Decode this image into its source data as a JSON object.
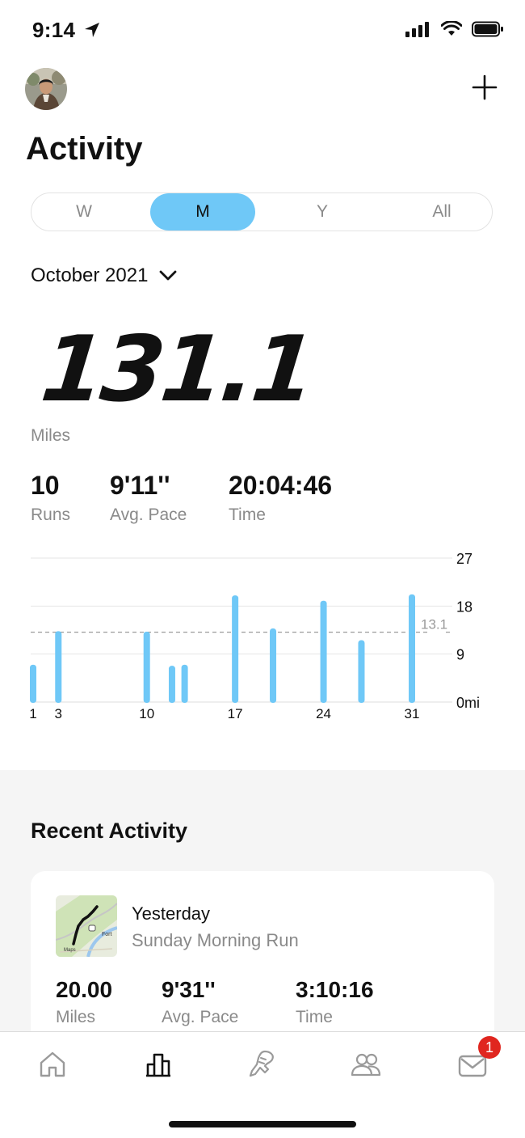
{
  "status_bar": {
    "time": "9:14"
  },
  "header": {
    "title": "Activity"
  },
  "segments": [
    "W",
    "M",
    "Y",
    "All"
  ],
  "selected_segment": "M",
  "month_selector": {
    "label": "October 2021"
  },
  "summary": {
    "distance": "131.1",
    "distance_label": "Miles",
    "stats": [
      {
        "value": "10",
        "label": "Runs"
      },
      {
        "value": "9'11''",
        "label": "Avg. Pace"
      },
      {
        "value": "20:04:46",
        "label": "Time"
      }
    ]
  },
  "chart_data": {
    "type": "bar",
    "x_ticks": [
      "1",
      "3",
      "10",
      "17",
      "24",
      "31"
    ],
    "y_ticks": [
      "27",
      "18",
      "9",
      "0mi"
    ],
    "ylim": [
      0,
      27
    ],
    "average_line": {
      "value": 13.1,
      "label": "13.1"
    },
    "days": [
      1,
      3,
      10,
      12,
      13,
      17,
      20,
      24,
      27,
      31
    ],
    "values": [
      7.0,
      13.3,
      13.2,
      6.8,
      7.0,
      20.0,
      13.8,
      19.0,
      11.6,
      20.2
    ],
    "bar_color": "#6fc8f7"
  },
  "recent": {
    "title": "Recent Activity",
    "card": {
      "when": "Yesterday",
      "name": "Sunday Morning Run",
      "map_label_fort": "Fort",
      "map_label_maps": "Maps",
      "stats": [
        {
          "value": "20.00",
          "label": "Miles"
        },
        {
          "value": "9'31''",
          "label": "Avg. Pace"
        },
        {
          "value": "3:10:16",
          "label": "Time"
        }
      ]
    }
  },
  "tabbar": {
    "tabs": [
      "home-icon",
      "activity-chart-icon",
      "run-icon",
      "club-icon",
      "inbox-icon"
    ],
    "selected": "activity-chart-icon",
    "inbox_badge": "1"
  },
  "colors": {
    "accent": "#6fc8f7",
    "badge": "#e0261f",
    "muted": "#8a8a8a"
  }
}
